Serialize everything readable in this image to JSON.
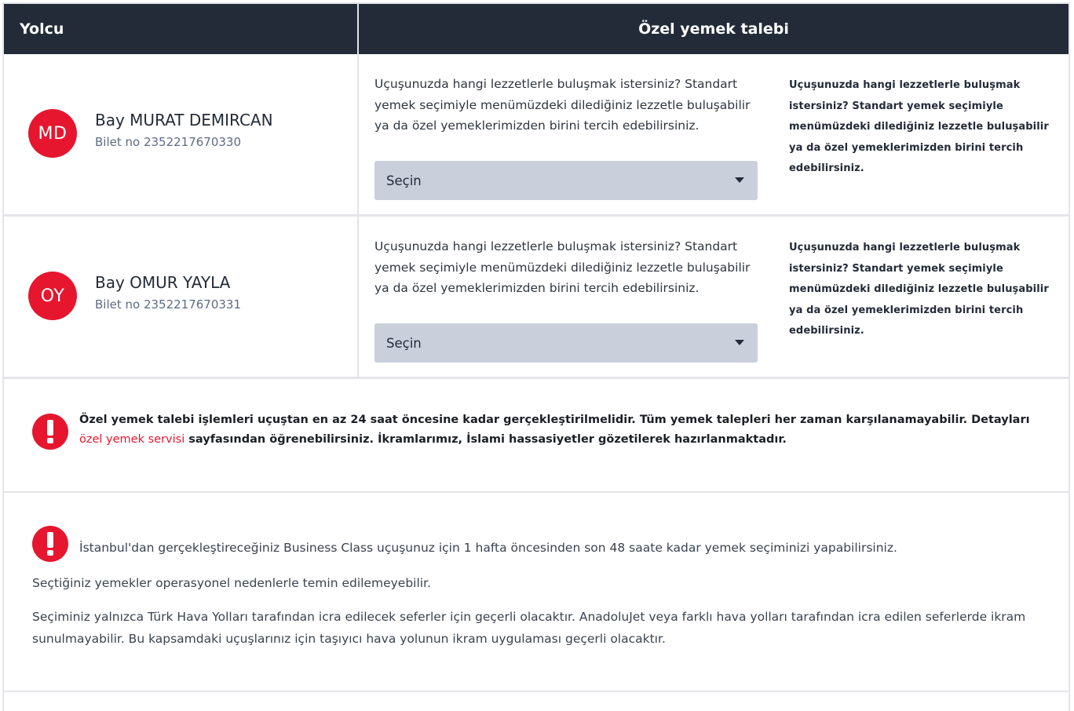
{
  "header": {
    "passenger_label": "Yolcu",
    "meal_label": "Özel yemek talebi"
  },
  "passengers": [
    {
      "initials": "MD",
      "name": "Bay MURAT DEMIRCAN",
      "ticket": "Bilet no 2352217670330",
      "meal_question": "Uçuşunuzda hangi lezzetlerle buluşmak istersiniz? Standart yemek seçimiyle menümüzdeki dilediğiniz lezzetle buluşabilir ya da özel yemeklerimizden birini tercih edebilirsiniz.",
      "select_value": "Seçin",
      "note": "Uçuşunuzda hangi lezzetlerle buluşmak istersiniz? Standart yemek seçimiyle menümüzdeki dilediğiniz lezzetle buluşabilir ya da özel yemeklerimizden birini tercih edebilirsiniz."
    },
    {
      "initials": "OY",
      "name": "Bay OMUR YAYLA",
      "ticket": "Bilet no 2352217670331",
      "meal_question": "Uçuşunuzda hangi lezzetlerle buluşmak istersiniz? Standart yemek seçimiyle menümüzdeki dilediğiniz lezzetle buluşabilir ya da özel yemeklerimizden birini tercih edebilirsiniz.",
      "select_value": "Seçin",
      "note": "Uçuşunuzda hangi lezzetlerle buluşmak istersiniz? Standart yemek seçimiyle menümüzdeki dilediğiniz lezzetle buluşabilir ya da özel yemeklerimizden birini tercih edebilirsiniz."
    }
  ],
  "notice1": {
    "text_before": "Özel yemek talebi işlemleri uçuştan en az 24 saat öncesine kadar gerçekleştirilmelidir. Tüm yemek talepleri her zaman karşılanamayabilir. Detayları ",
    "link": "özel yemek servisi",
    "text_after": " sayfasından öğrenebilirsiniz. İkramlarımız, İslami hassasiyetler gözetilerek hazırlanmaktadır."
  },
  "notice2": {
    "line1": "İstanbul'dan gerçekleştireceğiniz Business Class uçuşunuz için 1 hafta öncesinden son 48 saate kadar yemek seçiminizi yapabilirsiniz.",
    "line2": "Seçtiğiniz yemekler operasyonel nedenlerle temin edilemeyebilir.",
    "line3": "Seçiminiz yalnızca Türk Hava Yolları tarafından icra edilecek seferler için geçerli olacaktır. AnadoluJet veya farklı hava yolları tarafından icra edilen seferlerde ikram sunulmayabilir. Bu kapsamdaki uçuşlarınız için taşıyıcı hava yolunun ikram uygulaması geçerli olacaktır."
  },
  "colors": {
    "header_bg": "#232b38",
    "accent_red": "#e5162e",
    "select_bg": "#c9d0dc",
    "ticket_text": "#5d6b86"
  },
  "icons": {
    "warning": "exclamation-circle-icon",
    "dropdown": "caret-down-icon"
  }
}
